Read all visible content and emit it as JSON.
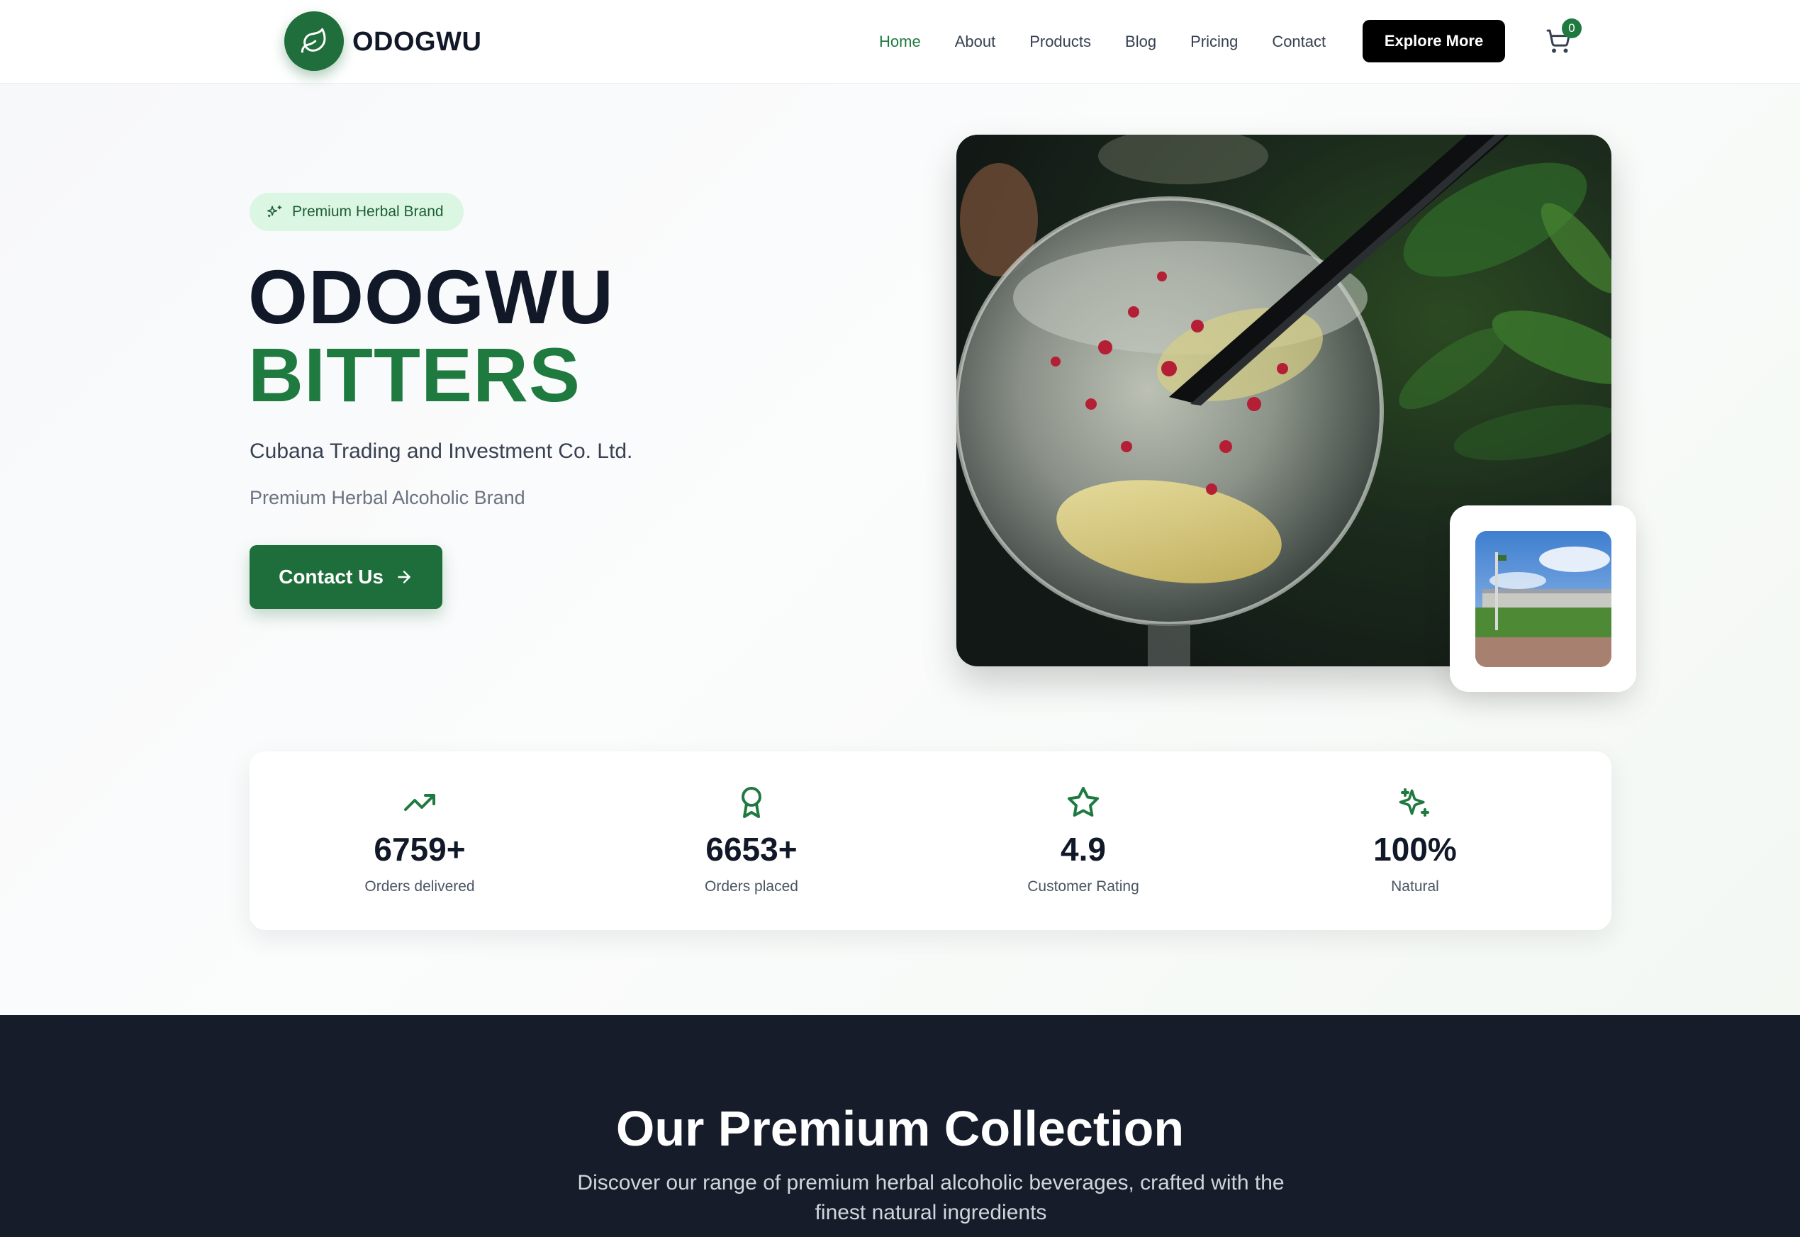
{
  "brand": {
    "name": "ODOGWU",
    "logo_icon": "leaf-icon",
    "accent_color": "#1f7a40",
    "dark_color": "#161c2a"
  },
  "nav": {
    "items": [
      {
        "label": "Home",
        "active": true
      },
      {
        "label": "About",
        "active": false
      },
      {
        "label": "Products",
        "active": false
      },
      {
        "label": "Blog",
        "active": false
      },
      {
        "label": "Pricing",
        "active": false
      },
      {
        "label": "Contact",
        "active": false
      }
    ],
    "cta_label": "Explore More",
    "cart_icon": "shopping-cart-icon",
    "cart_count": "0"
  },
  "hero": {
    "badge_icon": "sparkles-icon",
    "badge_label": "Premium Herbal Brand",
    "title_line1": "ODOGWU",
    "title_line2": "BITTERS",
    "company": "Cubana Trading and Investment Co. Ltd.",
    "tagline": "Premium Herbal Alcoholic Brand",
    "contact_label": "Contact Us",
    "contact_icon": "arrow-right-icon"
  },
  "stats": [
    {
      "icon": "trending-up-icon",
      "value": "6759+",
      "label": "Orders delivered"
    },
    {
      "icon": "award-icon",
      "value": "6653+",
      "label": "Orders placed"
    },
    {
      "icon": "star-icon",
      "value": "4.9",
      "label": "Customer Rating"
    },
    {
      "icon": "sparkles-icon",
      "value": "100%",
      "label": "Natural"
    }
  ],
  "collection": {
    "title": "Our Premium Collection",
    "subtitle": "Discover our range of premium herbal alcoholic beverages, crafted with the finest natural ingredients"
  }
}
